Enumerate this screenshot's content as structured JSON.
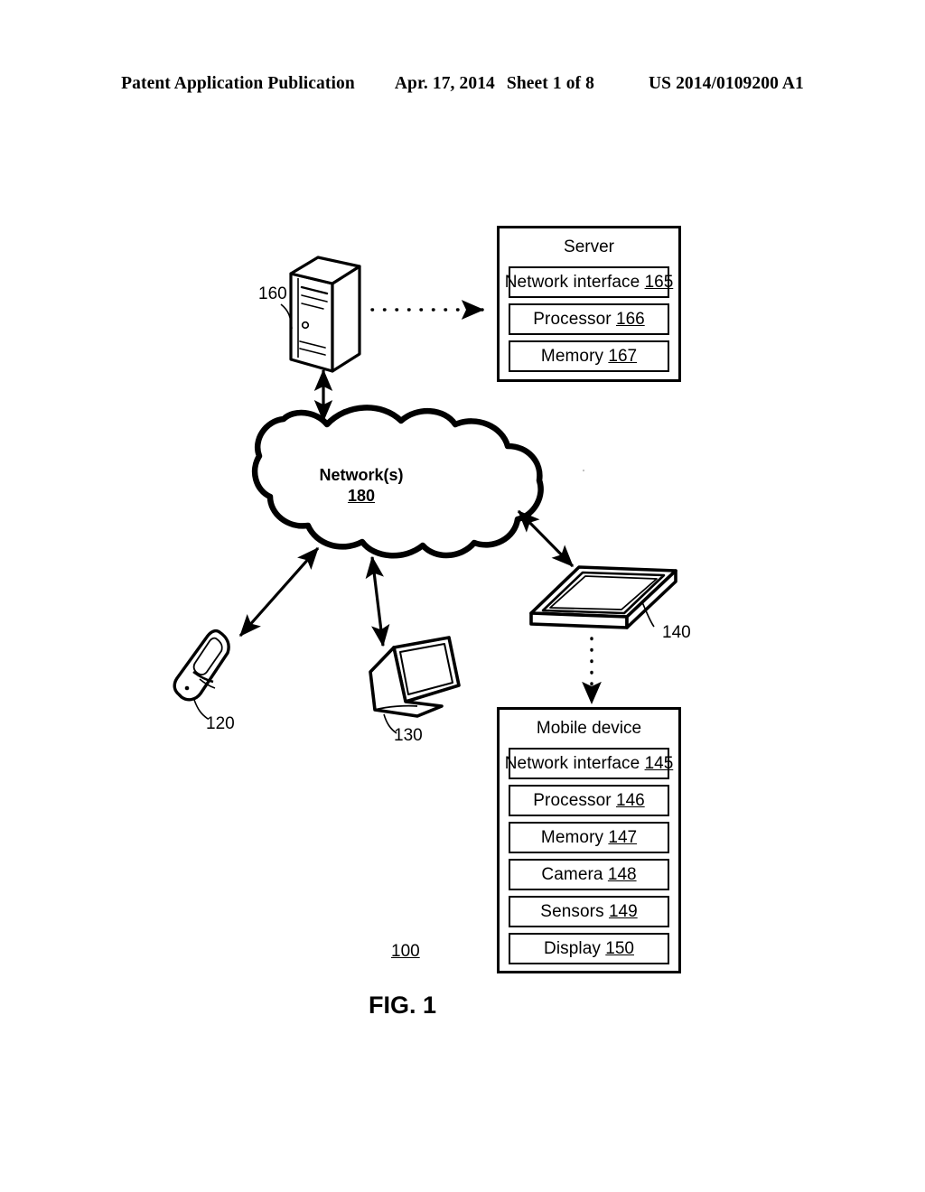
{
  "header": {
    "publication": "Patent Application Publication",
    "date": "Apr. 17, 2014",
    "sheet": "Sheet 1 of 8",
    "number": "US 2014/0109200 A1"
  },
  "figure": {
    "caption": "FIG. 1",
    "system_ref": "100"
  },
  "cloud": {
    "label": "Network(s)",
    "ref": "180"
  },
  "devices": {
    "server_tower_ref": "160",
    "phone_ref": "120",
    "laptop_ref": "130",
    "tablet_ref": "140"
  },
  "server_box": {
    "title": "Server",
    "items": [
      {
        "label": "Network interface",
        "ref": "165"
      },
      {
        "label": "Processor",
        "ref": "166"
      },
      {
        "label": "Memory",
        "ref": "167"
      }
    ]
  },
  "mobile_box": {
    "title": "Mobile device",
    "items": [
      {
        "label": "Network interface",
        "ref": "145"
      },
      {
        "label": "Processor",
        "ref": "146"
      },
      {
        "label": "Memory",
        "ref": "147"
      },
      {
        "label": "Camera",
        "ref": "148"
      },
      {
        "label": "Sensors",
        "ref": "149"
      },
      {
        "label": "Display",
        "ref": "150"
      }
    ]
  },
  "colors": {
    "ink": "#000000",
    "paper": "#ffffff"
  }
}
